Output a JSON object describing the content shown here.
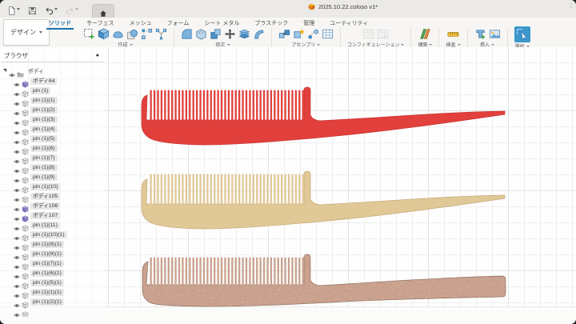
{
  "titlebar": {
    "document_title": "2025.10.22.coloso v1*"
  },
  "workspace": {
    "label": "デザイン"
  },
  "ribbon": {
    "tabs": [
      {
        "label": "ソリッド",
        "active": true
      },
      {
        "label": "サーフェス",
        "active": false
      },
      {
        "label": "メッシュ",
        "active": false
      },
      {
        "label": "フォーム",
        "active": false
      },
      {
        "label": "シート メタル",
        "active": false
      },
      {
        "label": "プラスチック",
        "active": false
      },
      {
        "label": "管理",
        "active": false
      },
      {
        "label": "ユーティリティ",
        "active": false
      }
    ],
    "groups": [
      {
        "label": "作成",
        "icons": [
          "sketch",
          "extrude",
          "sweep",
          "sphere",
          "pattern",
          "branch"
        ],
        "disabled": false,
        "highlight": false
      },
      {
        "label": "修正",
        "icons": [
          "fillet",
          "shell",
          "combine",
          "move",
          "split",
          "offset"
        ],
        "disabled": false,
        "highlight": false
      },
      {
        "label": "アセンブリ",
        "icons": [
          "link",
          "new-component",
          "joint",
          "bom"
        ],
        "disabled": false,
        "highlight": false
      },
      {
        "label": "コンフィギュレーション",
        "icons": [
          "config-table",
          "config-insert"
        ],
        "disabled": true,
        "highlight": false
      },
      {
        "label": "構築",
        "icons": [
          "planes"
        ],
        "disabled": false,
        "highlight": false
      },
      {
        "label": "検査",
        "icons": [
          "measure"
        ],
        "disabled": false,
        "highlight": false
      },
      {
        "label": "挿入",
        "icons": [
          "canvas",
          "image"
        ],
        "disabled": false,
        "highlight": false
      },
      {
        "label": "選択",
        "icons": [
          "select"
        ],
        "disabled": false,
        "highlight": true
      }
    ]
  },
  "browser": {
    "title": "ブラウザ",
    "items": [
      {
        "label": "ボディ",
        "icon": "folder"
      },
      {
        "label": "ボディ64",
        "icon": "body-purple"
      },
      {
        "label": "pin (1)",
        "icon": "body"
      },
      {
        "label": "pin (1)(1)",
        "icon": "body"
      },
      {
        "label": "pin (1)(2)",
        "icon": "body"
      },
      {
        "label": "pin (1)(3)",
        "icon": "body"
      },
      {
        "label": "pin (1)(4)",
        "icon": "body"
      },
      {
        "label": "pin (1)(5)",
        "icon": "body"
      },
      {
        "label": "pin (1)(6)",
        "icon": "body"
      },
      {
        "label": "pin (1)(7)",
        "icon": "body"
      },
      {
        "label": "pin (1)(8)",
        "icon": "body"
      },
      {
        "label": "pin (1)(9)",
        "icon": "body"
      },
      {
        "label": "pin (1)(10)",
        "icon": "body"
      },
      {
        "label": "ボディ105",
        "icon": "body"
      },
      {
        "label": "ボディ106",
        "icon": "body-purple"
      },
      {
        "label": "ボディ107",
        "icon": "body-purple"
      },
      {
        "label": "pin (1)(11)",
        "icon": "body"
      },
      {
        "label": "pin (1)(10)(1)",
        "icon": "body"
      },
      {
        "label": "pin (1)(8)(1)",
        "icon": "body"
      },
      {
        "label": "pin (1)(9)(1)",
        "icon": "body"
      },
      {
        "label": "pin (1)(7)(1)",
        "icon": "body"
      },
      {
        "label": "pin (1)(6)(1)",
        "icon": "body"
      },
      {
        "label": "pin (1)(5)(1)",
        "icon": "body"
      },
      {
        "label": "pin (1)(1)(1)",
        "icon": "body"
      },
      {
        "label": "pin (1)(2)(1)",
        "icon": "body"
      },
      {
        "label": "",
        "icon": "body"
      }
    ]
  },
  "viewport": {
    "combs": [
      {
        "name": "comb-red",
        "color": "#e2403c",
        "edge": "#c5332f"
      },
      {
        "name": "comb-tan",
        "color": "#e1c897",
        "edge": "#c3a876"
      },
      {
        "name": "comb-granite",
        "color": "#c9a08c",
        "edge": "#8f7260"
      }
    ],
    "grid_minor": "#efefee",
    "grid_major": "#dfe4df"
  },
  "colors": {
    "accent_blue": "#1a72ae",
    "select_button": "#3d96cc"
  }
}
